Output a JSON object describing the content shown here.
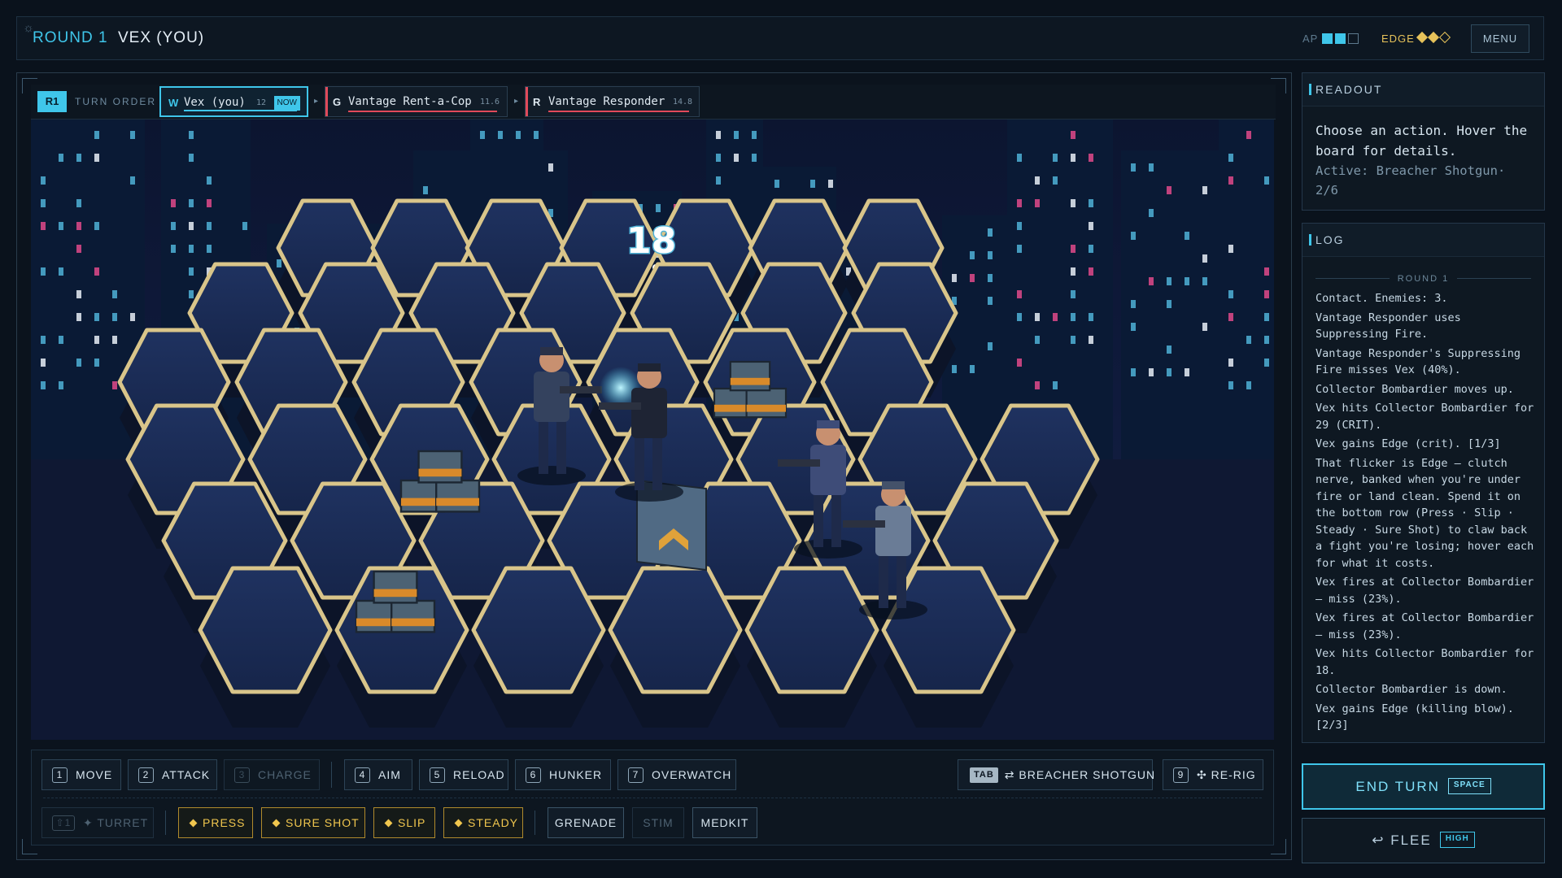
{
  "header": {
    "round_label": "ROUND 1",
    "actor_label": "VEX (YOU)",
    "ap": {
      "label": "AP",
      "current": 2,
      "max": 3
    },
    "edge": {
      "label": "EDGE",
      "current": 2,
      "max": 3
    },
    "menu_label": "MENU"
  },
  "turn_order": {
    "round_badge": "R1",
    "label": "TURN ORDER",
    "units": [
      {
        "letter": "W",
        "name": "Vex (you)",
        "initiative": "12",
        "badge": "NOW",
        "active": true,
        "bar_color": "#3fc6ea"
      },
      {
        "letter": "G",
        "name": "Vantage Rent-a-Cop",
        "initiative": "11.6",
        "bar_color": "#e04a5a"
      },
      {
        "letter": "R",
        "name": "Vantage Responder",
        "initiative": "14.8",
        "bar_color": "#e04a5a"
      }
    ]
  },
  "scene": {
    "damage_number": "18",
    "units": [
      {
        "name": "Vex",
        "role": "player"
      },
      {
        "name": "Vantage Rent-a-Cop",
        "role": "enemy"
      },
      {
        "name": "Vantage Responder",
        "role": "enemy"
      },
      {
        "name": "Collector Bombardier",
        "role": "enemy"
      }
    ]
  },
  "actions": {
    "row1": [
      {
        "key": "1",
        "label": "MOVE",
        "disabled": false
      },
      {
        "key": "2",
        "label": "ATTACK",
        "disabled": false
      },
      {
        "key": "3",
        "label": "CHARGE",
        "disabled": true
      },
      {
        "key": "4",
        "label": "AIM",
        "disabled": false
      },
      {
        "key": "5",
        "label": "RELOAD",
        "disabled": false
      },
      {
        "key": "6",
        "label": "HUNKER",
        "disabled": false
      },
      {
        "key": "7",
        "label": "OVERWATCH",
        "disabled": false
      }
    ],
    "weapon": {
      "key": "TAB",
      "label": "⇄ BREACHER SHOTGUN"
    },
    "rerig": {
      "key": "9",
      "label": "✣ RE-RIG"
    },
    "turret": {
      "key": "⇧1",
      "label": "✦ TURRET",
      "disabled": true
    },
    "edge_actions": [
      "PRESS",
      "SURE SHOT",
      "SLIP",
      "STEADY"
    ],
    "items": [
      {
        "label": "GRENADE",
        "disabled": false
      },
      {
        "label": "STIM",
        "disabled": true
      },
      {
        "label": "MEDKIT",
        "disabled": false
      }
    ]
  },
  "readout": {
    "title": "READOUT",
    "text": "Choose an action. Hover the board for details.",
    "active": "Active: Breacher Shotgun· 2/6"
  },
  "log": {
    "title": "LOG",
    "round_label": "ROUND 1",
    "entries": [
      "Contact. Enemies: 3.",
      "Vantage Responder uses Suppressing Fire.",
      "Vantage Responder's Suppressing Fire misses Vex (40%).",
      "Collector Bombardier moves up.",
      "Vex hits Collector Bombardier for 29 (CRIT).",
      "Vex gains Edge (crit). [1/3]",
      "That flicker is Edge — clutch nerve, banked when you're under fire or land clean. Spend it on the bottom row (Press · Slip · Steady · Sure Shot) to claw back a fight you're losing; hover each for what it costs.",
      "Vex fires at Collector Bombardier — miss (23%).",
      "Vex fires at Collector Bombardier — miss (23%).",
      "Vex hits Collector Bombardier for 18.",
      "Collector Bombardier is down.",
      "Vex gains Edge (killing blow). [2/3]"
    ]
  },
  "end_turn": {
    "label": "END TURN",
    "key": "SPACE"
  },
  "flee": {
    "label": "↩ FLEE",
    "risk": "HIGH"
  },
  "colors": {
    "accent": "#3fc6ea",
    "edge": "#e6c25a",
    "enemy": "#e04a5a",
    "hex_fill": "#1b2c54",
    "hex_border": "#d9c58a"
  }
}
